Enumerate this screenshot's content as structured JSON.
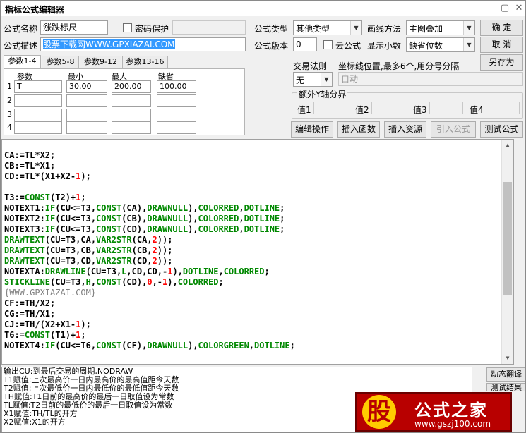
{
  "window": {
    "title": "指标公式编辑器",
    "minimize": "▢",
    "close": "✕"
  },
  "form": {
    "name_label": "公式名称",
    "name_value": "涨跌标尺",
    "password_label": "密码保护",
    "type_label": "公式类型",
    "type_value": "其他类型",
    "draw_label": "画线方法",
    "draw_value": "主图叠加",
    "desc_label": "公式描述",
    "desc_value": "股票下载网WWW.GPXIAZAI.COM",
    "version_label": "公式版本",
    "version_value": "0",
    "cloud_label": "云公式",
    "decimal_label": "显示小数",
    "decimal_value": "缺省位数"
  },
  "buttons": {
    "ok": "确 定",
    "cancel": "取 消",
    "save_as": "另存为",
    "edit": "编辑操作",
    "insert_func": "插入函数",
    "insert_res": "插入资源",
    "import": "引入公式",
    "test": "测试公式"
  },
  "tabs": [
    "参数1-4",
    "参数5-8",
    "参数9-12",
    "参数13-16"
  ],
  "params": {
    "headers": [
      "参数",
      "最小",
      "最大",
      "缺省"
    ],
    "row_numbers": [
      "1",
      "2",
      "3",
      "4"
    ],
    "rows": [
      [
        "T",
        "30.00",
        "200.00",
        "100.00"
      ],
      [
        "",
        "",
        "",
        ""
      ],
      [
        "",
        "",
        "",
        ""
      ],
      [
        "",
        "",
        "",
        ""
      ]
    ]
  },
  "trade": {
    "label": "交易法则",
    "value": "无",
    "coord_label": "坐标线位置,最多6个,用分号分隔",
    "coord_value": "自动"
  },
  "yaxis": {
    "label": "额外Y轴分界",
    "v1": "值1",
    "v2": "值2",
    "v3": "值3",
    "v4": "值4"
  },
  "code_colors": {
    "default": "#000000",
    "func": "#008800",
    "num": "#ff0000",
    "comment": "#808080",
    "const": "#0000ff"
  },
  "code_lines": [
    [],
    [
      [
        "CA:=TL*X2;",
        "d"
      ]
    ],
    [
      [
        "CB:=TL*X1;",
        "d"
      ]
    ],
    [
      [
        "CD:=TL*(X1+X2-",
        "d"
      ],
      [
        "1",
        "n"
      ],
      [
        ");",
        "d"
      ]
    ],
    [],
    [
      [
        "T3:=",
        "d"
      ],
      [
        "CONST",
        "f"
      ],
      [
        "(T2)+",
        "d"
      ],
      [
        "1",
        "n"
      ],
      [
        ";",
        "d"
      ]
    ],
    [
      [
        "NOTEXT1:",
        "d"
      ],
      [
        "IF",
        "f"
      ],
      [
        "(CU<=T3,",
        "d"
      ],
      [
        "CONST",
        "f"
      ],
      [
        "(CA),",
        "d"
      ],
      [
        "DRAWNULL",
        "f"
      ],
      [
        "),",
        "d"
      ],
      [
        "COLORRED",
        "f"
      ],
      [
        ",",
        "d"
      ],
      [
        "DOTLINE",
        "f"
      ],
      [
        ";",
        "d"
      ]
    ],
    [
      [
        "NOTEXT2:",
        "d"
      ],
      [
        "IF",
        "f"
      ],
      [
        "(CU<=T3,",
        "d"
      ],
      [
        "CONST",
        "f"
      ],
      [
        "(CB),",
        "d"
      ],
      [
        "DRAWNULL",
        "f"
      ],
      [
        "),",
        "d"
      ],
      [
        "COLORRED",
        "f"
      ],
      [
        ",",
        "d"
      ],
      [
        "DOTLINE",
        "f"
      ],
      [
        ";",
        "d"
      ]
    ],
    [
      [
        "NOTEXT3:",
        "d"
      ],
      [
        "IF",
        "f"
      ],
      [
        "(CU<=T3,",
        "d"
      ],
      [
        "CONST",
        "f"
      ],
      [
        "(CD),",
        "d"
      ],
      [
        "DRAWNULL",
        "f"
      ],
      [
        "),",
        "d"
      ],
      [
        "COLORRED",
        "f"
      ],
      [
        ",",
        "d"
      ],
      [
        "DOTLINE",
        "f"
      ],
      [
        ";",
        "d"
      ]
    ],
    [
      [
        "DRAWTEXT",
        "f"
      ],
      [
        "(CU=T3,CA,",
        "d"
      ],
      [
        "VAR2STR",
        "f"
      ],
      [
        "(CA,",
        "d"
      ],
      [
        "2",
        "n"
      ],
      [
        "));",
        "d"
      ]
    ],
    [
      [
        "DRAWTEXT",
        "f"
      ],
      [
        "(CU=T3,CB,",
        "d"
      ],
      [
        "VAR2STR",
        "f"
      ],
      [
        "(CB,",
        "d"
      ],
      [
        "2",
        "n"
      ],
      [
        "));",
        "d"
      ]
    ],
    [
      [
        "DRAWTEXT",
        "f"
      ],
      [
        "(CU=T3,CD,",
        "d"
      ],
      [
        "VAR2STR",
        "f"
      ],
      [
        "(CD,",
        "d"
      ],
      [
        "2",
        "n"
      ],
      [
        "));",
        "d"
      ]
    ],
    [
      [
        "NOTEXTA:",
        "d"
      ],
      [
        "DRAWLINE",
        "f"
      ],
      [
        "(CU=T3,",
        "d"
      ],
      [
        "L",
        "f"
      ],
      [
        ",CD,CD,-",
        "d"
      ],
      [
        "1",
        "n"
      ],
      [
        "),",
        "d"
      ],
      [
        "DOTLINE",
        "f"
      ],
      [
        ",",
        "d"
      ],
      [
        "COLORRED",
        "f"
      ],
      [
        ";",
        "d"
      ]
    ],
    [
      [
        "STICKLINE",
        "f"
      ],
      [
        "(CU=T3,",
        "d"
      ],
      [
        "H",
        "f"
      ],
      [
        ",",
        "d"
      ],
      [
        "CONST",
        "f"
      ],
      [
        "(CD),",
        "d"
      ],
      [
        "0",
        "n"
      ],
      [
        ",-",
        "d"
      ],
      [
        "1",
        "n"
      ],
      [
        "),",
        "d"
      ],
      [
        "COLORRED",
        "f"
      ],
      [
        ";",
        "d"
      ]
    ],
    [
      [
        "{WWW.GPXIAZAI.COM}",
        "c"
      ]
    ],
    [
      [
        "CF:=TH/X2;",
        "d"
      ]
    ],
    [
      [
        "CG:=TH/X1;",
        "d"
      ]
    ],
    [
      [
        "CJ:=TH/(X2+X1-",
        "d"
      ],
      [
        "1",
        "n"
      ],
      [
        ");",
        "d"
      ]
    ],
    [
      [
        "T6:=",
        "d"
      ],
      [
        "CONST",
        "f"
      ],
      [
        "(T1)+",
        "d"
      ],
      [
        "1",
        "n"
      ],
      [
        ";",
        "d"
      ]
    ],
    [
      [
        "NOTEXT4:",
        "d"
      ],
      [
        "IF",
        "f"
      ],
      [
        "(CU<=T6,",
        "d"
      ],
      [
        "CONST",
        "f"
      ],
      [
        "(CF),",
        "d"
      ],
      [
        "DRAWNULL",
        "f"
      ],
      [
        "),",
        "d"
      ],
      [
        "COLORGREEN",
        "f"
      ],
      [
        ",",
        "d"
      ],
      [
        "DOTLINE",
        "f"
      ],
      [
        ";",
        "d"
      ]
    ]
  ],
  "output_lines": [
    "输出CU:到最后交易的周期,NODRAW",
    "T1赋值:上次最高价一日内最高价的最高值距今天数",
    "T2赋值:上次最低价一日内最低价的最低值距今天数",
    "TH赋值:T1日前的最高价的最后一日取值设为常数",
    "TL赋值:T2日前的最低价的最后一日取值设为常数",
    "X1赋值:TH/TL的开方",
    "X2赋值:X1的开方"
  ],
  "side": {
    "translate": "动态翻译",
    "test_result": "测试结果"
  },
  "logo": {
    "char": "股",
    "text": "公式之家",
    "url": "www.gszj100.com"
  }
}
